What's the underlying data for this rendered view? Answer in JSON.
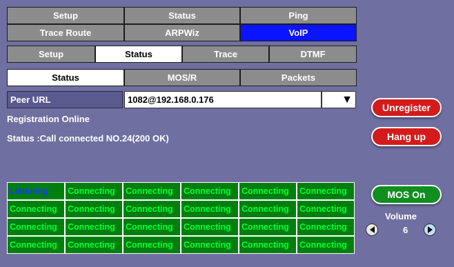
{
  "top_tabs": {
    "row1": [
      "Setup",
      "Status",
      "Ping"
    ],
    "row2": [
      "Trace Route",
      "ARPWiz",
      "VoIP"
    ]
  },
  "sub_tabs": [
    "Setup",
    "Status",
    "Trace",
    "DTMF"
  ],
  "sub_sub_tabs": [
    "Status",
    "MOS/R",
    "Packets"
  ],
  "peer": {
    "label": "Peer URL",
    "value": "1082@192.168.0.176",
    "dropdown_icon": "triangle-down-icon"
  },
  "status": {
    "registration": "Registration Online",
    "call": "Status :Call connected NO.24(200 OK)"
  },
  "line_grid": [
    [
      "Listening",
      "Connecting",
      "Connecting",
      "Connecting",
      "Connecting",
      "Connecting"
    ],
    [
      "Connecting",
      "Connecting",
      "Connecting",
      "Connecting",
      "Connecting",
      "Connecting"
    ],
    [
      "Connecting",
      "Connecting",
      "Connecting",
      "Connecting",
      "Connecting",
      "Connecting"
    ],
    [
      "Connecting",
      "Connecting",
      "Connecting",
      "Connecting",
      "Connecting",
      "Connecting"
    ]
  ],
  "right_panel": {
    "unregister": "Unregister",
    "hangup": "Hang up",
    "mos": "MOS On",
    "volume_label": "Volume",
    "volume_value": "6"
  },
  "colors": {
    "background": "#6f6fa1",
    "accent_blue": "#0a14ff",
    "danger_red": "#d31b1b",
    "ok_green": "#0f8f1f",
    "cell_green": "#007f0f"
  }
}
